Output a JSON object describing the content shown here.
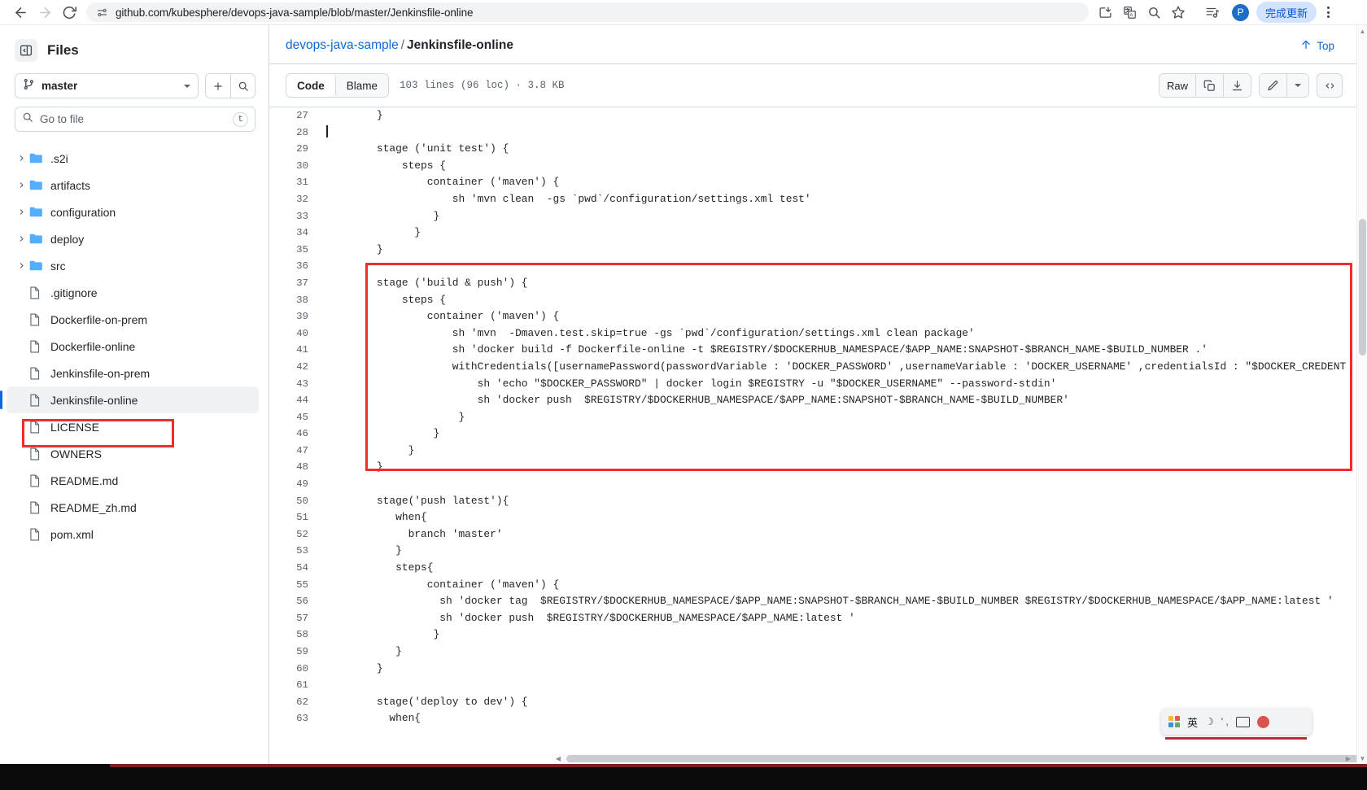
{
  "browser": {
    "url": "github.com/kubesphere/devops-java-sample/blob/master/Jenkinsfile-online",
    "back_icon": "back-arrow-icon",
    "forward_icon": "forward-arrow-icon",
    "reload_icon": "reload-icon",
    "site_info_icon": "site-settings-icon",
    "install_icon": "install-app-icon",
    "translate_icon": "translate-icon",
    "zoom_icon": "page-zoom-icon",
    "bookmark_icon": "bookmark-star-icon",
    "media_icon": "media-playlist-icon",
    "profile_initial": "P",
    "update_button_label": "完成更新",
    "menu_icon": "three-dot-menu-icon"
  },
  "sidebar": {
    "title": "Files",
    "panel_toggle_icon": "collapse-panel-icon",
    "branch": {
      "icon": "git-branch-icon",
      "name": "master",
      "add_label": "+",
      "search_icon": "search-icon"
    },
    "file_search": {
      "icon": "search-icon",
      "placeholder": "Go to file",
      "shortcut": "t"
    },
    "tree": [
      {
        "name": ".s2i",
        "type": "folder",
        "expanded": false,
        "selected": false
      },
      {
        "name": "artifacts",
        "type": "folder",
        "expanded": false,
        "selected": false
      },
      {
        "name": "configuration",
        "type": "folder",
        "expanded": false,
        "selected": false
      },
      {
        "name": "deploy",
        "type": "folder",
        "expanded": false,
        "selected": false
      },
      {
        "name": "src",
        "type": "folder",
        "expanded": false,
        "selected": false
      },
      {
        "name": ".gitignore",
        "type": "file",
        "selected": false
      },
      {
        "name": "Dockerfile-on-prem",
        "type": "file",
        "selected": false
      },
      {
        "name": "Dockerfile-online",
        "type": "file",
        "selected": false
      },
      {
        "name": "Jenkinsfile-on-prem",
        "type": "file",
        "selected": false
      },
      {
        "name": "Jenkinsfile-online",
        "type": "file",
        "selected": true
      },
      {
        "name": "LICENSE",
        "type": "file",
        "selected": false
      },
      {
        "name": "OWNERS",
        "type": "file",
        "selected": false
      },
      {
        "name": "README.md",
        "type": "file",
        "selected": false
      },
      {
        "name": "README_zh.md",
        "type": "file",
        "selected": false
      },
      {
        "name": "pom.xml",
        "type": "file",
        "selected": false
      }
    ]
  },
  "main": {
    "breadcrumb_repo": "devops-java-sample",
    "breadcrumb_sep": "/",
    "breadcrumb_file": "Jenkinsfile-online",
    "top_link_label": "Top",
    "top_link_icon": "arrow-up-icon",
    "tabs": [
      {
        "label": "Code",
        "active": true
      },
      {
        "label": "Blame",
        "active": false
      }
    ],
    "file_meta": "103 lines (96 loc) · 3.8 KB",
    "actions": {
      "raw_label": "Raw",
      "copy_icon": "copy-icon",
      "download_icon": "download-icon",
      "edit_icon": "pencil-edit-icon",
      "edit_caret_icon": "chevron-down-icon",
      "symbols_icon": "code-symbols-icon"
    },
    "code": [
      {
        "n": "27",
        "t": "        }"
      },
      {
        "n": "28",
        "t": "",
        "caret": true
      },
      {
        "n": "29",
        "t": "        stage ('unit test') {"
      },
      {
        "n": "30",
        "t": "            steps {"
      },
      {
        "n": "31",
        "t": "                container ('maven') {"
      },
      {
        "n": "32",
        "t": "                    sh 'mvn clean  -gs `pwd`/configuration/settings.xml test'"
      },
      {
        "n": "33",
        "t": "                 }"
      },
      {
        "n": "34",
        "t": "              }"
      },
      {
        "n": "35",
        "t": "        }"
      },
      {
        "n": "36",
        "t": ""
      },
      {
        "n": "37",
        "t": "        stage ('build & push') {"
      },
      {
        "n": "38",
        "t": "            steps {"
      },
      {
        "n": "39",
        "t": "                container ('maven') {"
      },
      {
        "n": "40",
        "t": "                    sh 'mvn  -Dmaven.test.skip=true -gs `pwd`/configuration/settings.xml clean package'"
      },
      {
        "n": "41",
        "t": "                    sh 'docker build -f Dockerfile-online -t $REGISTRY/$DOCKERHUB_NAMESPACE/$APP_NAME:SNAPSHOT-$BRANCH_NAME-$BUILD_NUMBER .'"
      },
      {
        "n": "42",
        "t": "                    withCredentials([usernamePassword(passwordVariable : 'DOCKER_PASSWORD' ,usernameVariable : 'DOCKER_USERNAME' ,credentialsId : \"$DOCKER_CREDENT"
      },
      {
        "n": "43",
        "t": "                        sh 'echo \"$DOCKER_PASSWORD\" | docker login $REGISTRY -u \"$DOCKER_USERNAME\" --password-stdin'"
      },
      {
        "n": "44",
        "t": "                        sh 'docker push  $REGISTRY/$DOCKERHUB_NAMESPACE/$APP_NAME:SNAPSHOT-$BRANCH_NAME-$BUILD_NUMBER'"
      },
      {
        "n": "45",
        "t": "                     }"
      },
      {
        "n": "46",
        "t": "                 }"
      },
      {
        "n": "47",
        "t": "             }"
      },
      {
        "n": "48",
        "t": "        }"
      },
      {
        "n": "49",
        "t": ""
      },
      {
        "n": "50",
        "t": "        stage('push latest'){"
      },
      {
        "n": "51",
        "t": "           when{"
      },
      {
        "n": "52",
        "t": "             branch 'master'"
      },
      {
        "n": "53",
        "t": "           }"
      },
      {
        "n": "54",
        "t": "           steps{"
      },
      {
        "n": "55",
        "t": "                container ('maven') {"
      },
      {
        "n": "56",
        "t": "                  sh 'docker tag  $REGISTRY/$DOCKERHUB_NAMESPACE/$APP_NAME:SNAPSHOT-$BRANCH_NAME-$BUILD_NUMBER $REGISTRY/$DOCKERHUB_NAMESPACE/$APP_NAME:latest '"
      },
      {
        "n": "57",
        "t": "                  sh 'docker push  $REGISTRY/$DOCKERHUB_NAMESPACE/$APP_NAME:latest '"
      },
      {
        "n": "58",
        "t": "                 }"
      },
      {
        "n": "59",
        "t": "           }"
      },
      {
        "n": "60",
        "t": "        }"
      },
      {
        "n": "61",
        "t": ""
      },
      {
        "n": "62",
        "t": "        stage('deploy to dev') {"
      },
      {
        "n": "63",
        "t": "          when{"
      }
    ]
  },
  "annotations": {
    "highlight_color": "#f02d2d",
    "code_box_label": "build-and-push-stage-highlight",
    "file_box_label": "jenkinsfile-online-highlight"
  },
  "ime": {
    "lang_label": "英",
    "moon_icon": "moon-icon",
    "comma_icon": "punctuation-icon",
    "keyboard_icon": "keyboard-icon",
    "badge_icon": "status-badge-icon"
  }
}
